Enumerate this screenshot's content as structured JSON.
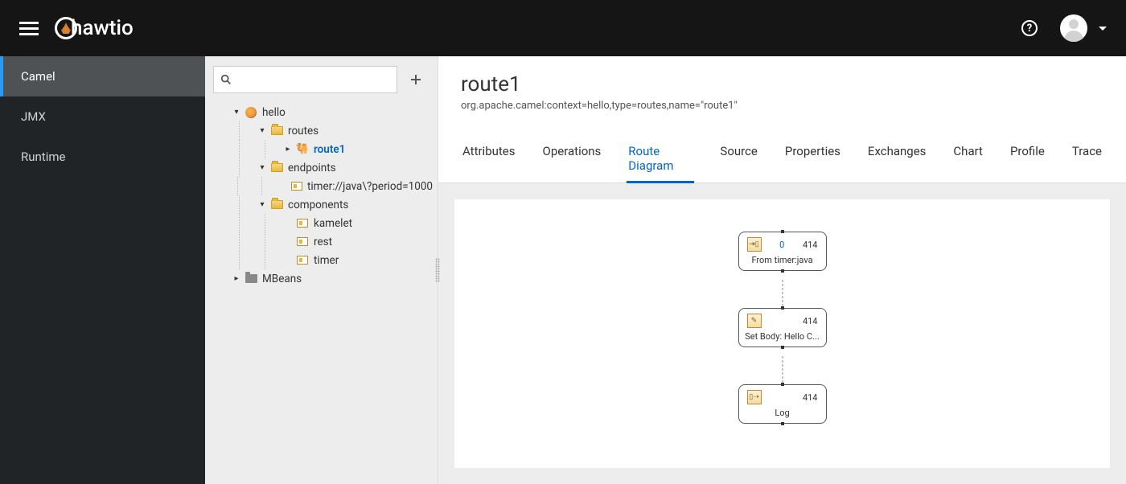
{
  "header": {
    "logo_text": "hawtio",
    "help": "?"
  },
  "sidebar": {
    "items": [
      {
        "label": "Camel",
        "active": true
      },
      {
        "label": "JMX",
        "active": false
      },
      {
        "label": "Runtime",
        "active": false
      }
    ]
  },
  "search": {
    "placeholder": "",
    "value": ""
  },
  "tree": {
    "root": {
      "label": "hello",
      "children": [
        {
          "label": "routes",
          "expanded": true,
          "children": [
            {
              "label": "route1",
              "selected": true,
              "icon": "route"
            }
          ]
        },
        {
          "label": "endpoints",
          "expanded": true,
          "children": [
            {
              "label": "timer://java\\?period=1000",
              "icon": "endpoint"
            }
          ]
        },
        {
          "label": "components",
          "expanded": true,
          "children": [
            {
              "label": "kamelet",
              "icon": "endpoint"
            },
            {
              "label": "rest",
              "icon": "endpoint"
            },
            {
              "label": "timer",
              "icon": "endpoint"
            }
          ]
        }
      ]
    },
    "mbeans": {
      "label": "MBeans"
    }
  },
  "main": {
    "title": "route1",
    "subtitle": "org.apache.camel:context=hello,type=routes,name=\"route1\"",
    "tabs": [
      {
        "label": "Attributes"
      },
      {
        "label": "Operations"
      },
      {
        "label": "Route Diagram",
        "active": true
      },
      {
        "label": "Source"
      },
      {
        "label": "Properties"
      },
      {
        "label": "Exchanges"
      },
      {
        "label": "Chart"
      },
      {
        "label": "Profile"
      },
      {
        "label": "Trace"
      }
    ]
  },
  "diagram": {
    "nodes": [
      {
        "label": "From timer:java",
        "inflight": "0",
        "total": "414",
        "icon": "from"
      },
      {
        "label": "Set Body: Hello C...",
        "inflight": "",
        "total": "414",
        "icon": "setbody"
      },
      {
        "label": "Log",
        "inflight": "",
        "total": "414",
        "icon": "log"
      }
    ]
  }
}
